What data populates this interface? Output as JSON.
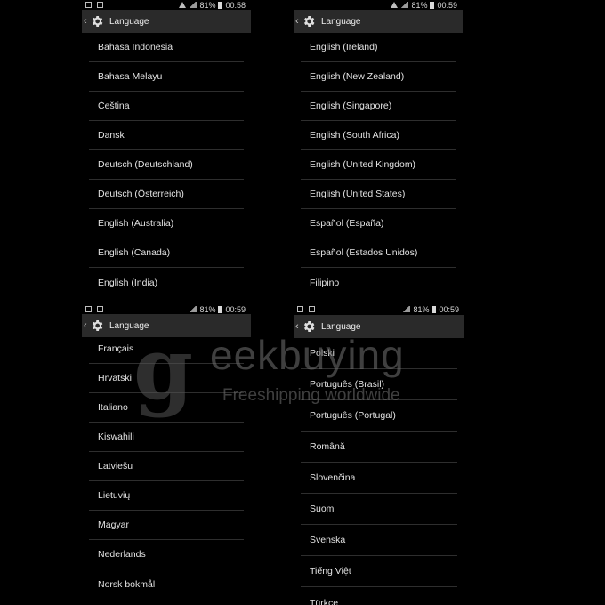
{
  "screens": [
    {
      "status": {
        "battery": "81%",
        "time": "00:58"
      },
      "title": "Language",
      "items": [
        "Bahasa Indonesia",
        "Bahasa Melayu",
        "Čeština",
        "Dansk",
        "Deutsch (Deutschland)",
        "Deutsch (Österreich)",
        "English (Australia)",
        "English (Canada)",
        "English (India)"
      ]
    },
    {
      "status": {
        "battery": "81%",
        "time": "00:59"
      },
      "title": "Language",
      "items": [
        "English (Ireland)",
        "English (New Zealand)",
        "English (Singapore)",
        "English (South Africa)",
        "English (United Kingdom)",
        "English (United States)",
        "Español (España)",
        "Español (Estados Unidos)",
        "Filipino"
      ]
    },
    {
      "status": {
        "battery": "81%",
        "time": "00:59"
      },
      "title": "Language",
      "items": [
        "Français",
        "Hrvatski",
        "Italiano",
        "Kiswahili",
        "Latviešu",
        "Lietuvių",
        "Magyar",
        "Nederlands",
        "Norsk bokmål"
      ]
    },
    {
      "status": {
        "battery": "81%",
        "time": "00:59"
      },
      "title": "Language",
      "items": [
        "Polski",
        "Português (Brasil)",
        "Português (Portugal)",
        "Română",
        "Slovenčina",
        "Suomi",
        "Svenska",
        "Tiếng Việt",
        "Türkçe"
      ]
    }
  ],
  "watermark": {
    "brand": "eekbuying",
    "tagline": "Freeshipping worldwide",
    "color": "#666666"
  },
  "icons": {
    "back": "chevron-left-icon",
    "settings": "gear-icon"
  }
}
